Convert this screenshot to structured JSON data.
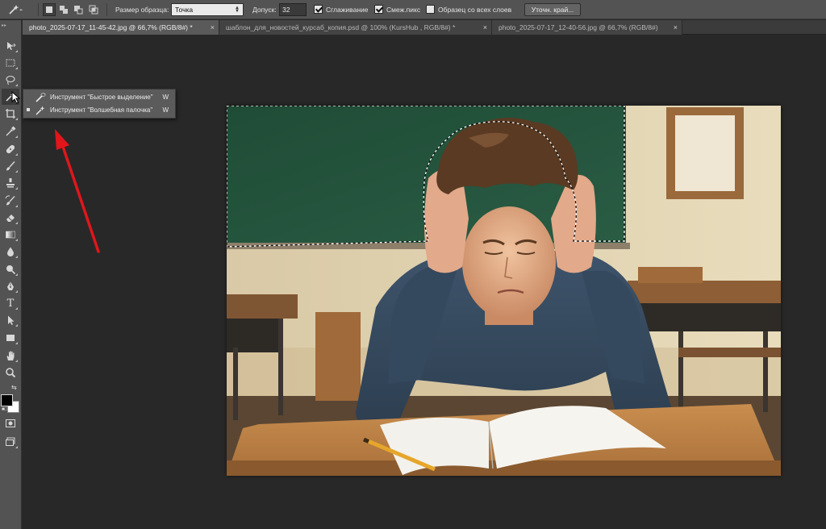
{
  "options_bar": {
    "sample_size_label": "Размер образца:",
    "sample_size_value": "Точка",
    "tolerance_label": "Допуск:",
    "tolerance_value": "32",
    "anti_alias_label": "Сглаживание",
    "anti_alias_checked": true,
    "contiguous_label": "Смеж.пикс",
    "contiguous_checked": true,
    "sample_all_layers_label": "Образец со всех слоев",
    "sample_all_layers_checked": false,
    "refine_edge_label": "Уточн. край..."
  },
  "tabs": [
    {
      "label": "photo_2025-07-17_11-45-42.jpg @ 66,7% (RGB/8#) *",
      "active": true
    },
    {
      "label": "шаблон_для_новостей_курсаб_копия.psd @ 100% (KursHub , RGB/8#) *",
      "active": false
    },
    {
      "label": "photo_2025-07-17_12-40-56.jpg @ 66,7% (RGB/8#)",
      "active": false
    }
  ],
  "tab_close_glyph": "×",
  "toolbar": {
    "tools": [
      "move-icon",
      "rect-marquee-icon",
      "lasso-icon",
      "magic-wand-icon",
      "crop-icon",
      "eyedropper-icon",
      "spot-healing-icon",
      "brush-icon",
      "clone-stamp-icon",
      "history-brush-icon",
      "eraser-icon",
      "gradient-icon",
      "blur-icon",
      "dodge-icon",
      "pen-icon",
      "type-icon",
      "path-select-icon",
      "shape-icon",
      "hand-icon",
      "zoom-icon"
    ],
    "foreground_color": "#000000",
    "background_color": "#ffffff",
    "type_tool_glyph": "T"
  },
  "flyout": {
    "items": [
      {
        "label": "Инструмент \"Быстрое выделение\"",
        "shortcut": "W",
        "icon": "quick-selection-icon",
        "current": false
      },
      {
        "label": "Инструмент \"Волшебная палочка\"",
        "shortcut": "W",
        "icon": "magic-wand-icon",
        "current": true
      }
    ]
  },
  "colors": {
    "workspace": "#282828",
    "panel": "#535353",
    "annotation_arrow": "#e0161b"
  }
}
